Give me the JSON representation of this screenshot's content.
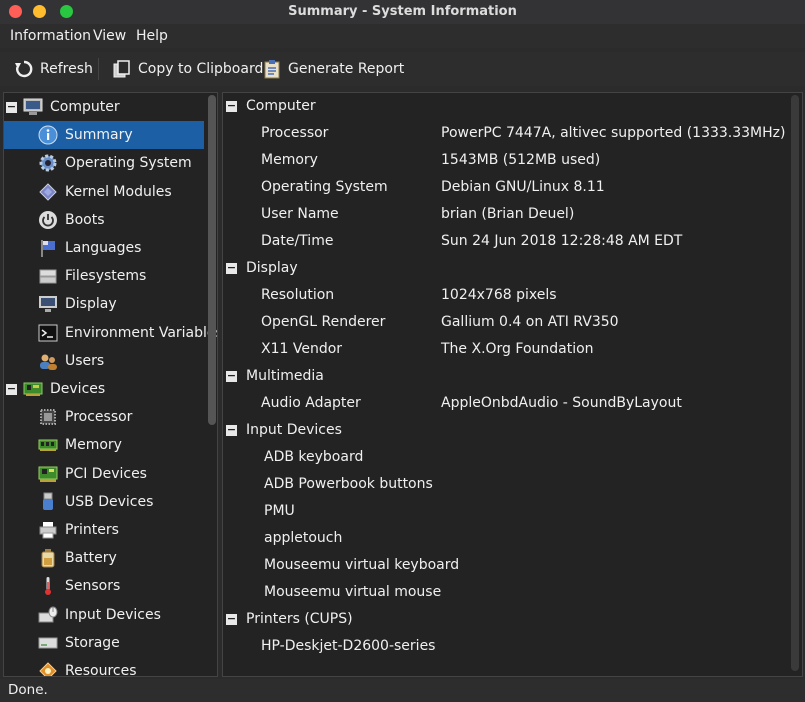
{
  "window": {
    "title": "Summary - System Information"
  },
  "menu": {
    "items": [
      "Information",
      "View",
      "Help"
    ]
  },
  "toolbar": {
    "refresh_label": "Refresh",
    "copy_label": "Copy to Clipboard",
    "report_label": "Generate Report"
  },
  "tree": {
    "items": [
      {
        "label": "Computer",
        "icon": "computer-icon",
        "level": 0,
        "expanded": true
      },
      {
        "label": "Summary",
        "icon": "info-icon",
        "level": 1,
        "selected": true
      },
      {
        "label": "Operating System",
        "icon": "os-gear-icon",
        "level": 1
      },
      {
        "label": "Kernel Modules",
        "icon": "kernel-modules-icon",
        "level": 1
      },
      {
        "label": "Boots",
        "icon": "power-icon",
        "level": 1
      },
      {
        "label": "Languages",
        "icon": "flag-icon",
        "level": 1
      },
      {
        "label": "Filesystems",
        "icon": "filesystem-icon",
        "level": 1
      },
      {
        "label": "Display",
        "icon": "monitor-icon",
        "level": 1
      },
      {
        "label": "Environment Variables",
        "icon": "terminal-icon",
        "level": 1
      },
      {
        "label": "Users",
        "icon": "users-icon",
        "level": 1
      },
      {
        "label": "Devices",
        "icon": "devices-icon",
        "level": 0,
        "expanded": true
      },
      {
        "label": "Processor",
        "icon": "cpu-icon",
        "level": 1
      },
      {
        "label": "Memory",
        "icon": "memory-icon",
        "level": 1
      },
      {
        "label": "PCI Devices",
        "icon": "pci-icon",
        "level": 1
      },
      {
        "label": "USB Devices",
        "icon": "usb-icon",
        "level": 1
      },
      {
        "label": "Printers",
        "icon": "printer-icon",
        "level": 1
      },
      {
        "label": "Battery",
        "icon": "battery-icon",
        "level": 1
      },
      {
        "label": "Sensors",
        "icon": "thermometer-icon",
        "level": 1
      },
      {
        "label": "Input Devices",
        "icon": "input-devices-icon",
        "level": 1
      },
      {
        "label": "Storage",
        "icon": "storage-icon",
        "level": 1
      },
      {
        "label": "Resources",
        "icon": "resources-icon",
        "level": 1
      }
    ]
  },
  "details": {
    "computer": {
      "title": "Computer",
      "rows": [
        {
          "key": "Processor",
          "value": "PowerPC 7447A, altivec supported (1333.33MHz)"
        },
        {
          "key": "Memory",
          "value": "1543MB (512MB used)"
        },
        {
          "key": "Operating System",
          "value": "Debian GNU/Linux 8.11"
        },
        {
          "key": "User Name",
          "value": "brian (Brian Deuel)"
        },
        {
          "key": "Date/Time",
          "value": "Sun 24 Jun 2018 12:28:48 AM EDT"
        }
      ]
    },
    "display": {
      "title": "Display",
      "rows": [
        {
          "key": "Resolution",
          "value": "1024x768 pixels"
        },
        {
          "key": "OpenGL Renderer",
          "value": "Gallium 0.4 on ATI RV350"
        },
        {
          "key": "X11 Vendor",
          "value": "The X.Org Foundation"
        }
      ]
    },
    "multimedia": {
      "title": "Multimedia",
      "rows": [
        {
          "key": "Audio Adapter",
          "value": "AppleOnbdAudio - SoundByLayout"
        }
      ]
    },
    "input_devices": {
      "title": "Input Devices",
      "items": [
        "ADB keyboard",
        "ADB Powerbook buttons",
        "PMU",
        "appletouch",
        "Mouseemu virtual keyboard",
        "Mouseemu virtual mouse"
      ]
    },
    "printers": {
      "title": "Printers (CUPS)",
      "items": [
        "HP-Deskjet-D2600-series"
      ]
    }
  },
  "status": {
    "text": "Done."
  }
}
